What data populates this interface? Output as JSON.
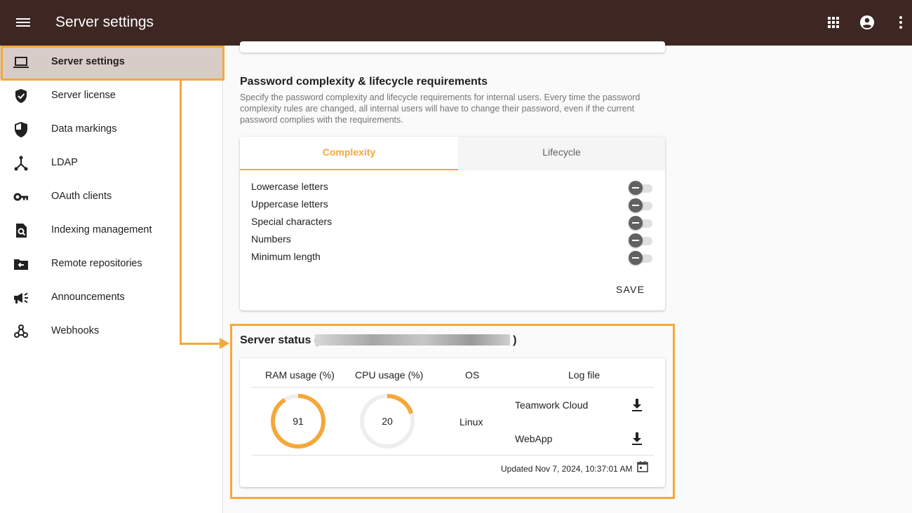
{
  "appbar": {
    "title": "Server settings",
    "icons": [
      "menu-icon",
      "apps-grid-icon",
      "account-circle-icon",
      "more-vert-icon"
    ],
    "color": "#3e2723"
  },
  "sidebar": {
    "items": [
      {
        "label": "Server settings",
        "icon": "laptop-icon",
        "active": true
      },
      {
        "label": "Server license",
        "icon": "verified-shield-icon"
      },
      {
        "label": "Data markings",
        "icon": "half-shield-icon"
      },
      {
        "label": "LDAP",
        "icon": "network-nodes-icon"
      },
      {
        "label": "OAuth clients",
        "icon": "key-icon"
      },
      {
        "label": "Indexing management",
        "icon": "document-search-icon"
      },
      {
        "label": "Remote repositories",
        "icon": "folder-arrow-icon"
      },
      {
        "label": "Announcements",
        "icon": "megaphone-icon"
      },
      {
        "label": "Webhooks",
        "icon": "webhook-icon"
      }
    ],
    "active_color": "#d7ccc8"
  },
  "password": {
    "title": "Password complexity & lifecycle requirements",
    "description": "Specify the password complexity and lifecycle requirements for internal users. Every time the password complexity rules are changed, all internal users will have to change their password, even if the current password complies with the requirements.",
    "tabs": [
      {
        "label": "Complexity",
        "active": true
      },
      {
        "label": "Lifecycle",
        "active": false
      }
    ],
    "options": [
      {
        "label": "Lowercase letters",
        "enabled": false
      },
      {
        "label": "Uppercase letters",
        "enabled": false
      },
      {
        "label": "Special characters",
        "enabled": false
      },
      {
        "label": "Numbers",
        "enabled": false
      },
      {
        "label": "Minimum length",
        "enabled": false
      }
    ],
    "save_label": "SAVE"
  },
  "status": {
    "title_prefix": "Server status (",
    "title_suffix": ")",
    "headers": {
      "ram": "RAM usage (%)",
      "cpu": "CPU usage (%)",
      "os": "OS",
      "log": "Log file"
    },
    "ram": {
      "value": "91",
      "fraction": 0.91
    },
    "cpu": {
      "value": "20",
      "fraction": 0.2
    },
    "os": "Linux",
    "logs": [
      {
        "label": "Teamwork Cloud"
      },
      {
        "label": "WebApp"
      }
    ],
    "updated": "Updated Nov 7, 2024, 10:37:01 AM"
  },
  "colors": {
    "accent": "#f5a83a",
    "gauge_track": "#eeeeee"
  }
}
